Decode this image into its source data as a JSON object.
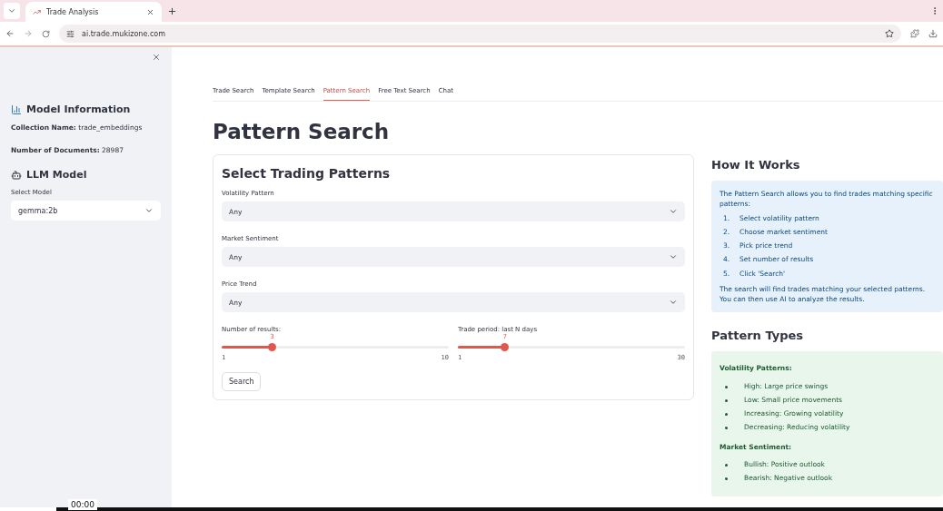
{
  "browser": {
    "tab_title": "Trade Analysis",
    "url": "ai.trade.mukizone.com"
  },
  "sidebar": {
    "sections": [
      {
        "kind": "info",
        "title": "Model Information",
        "lines": [
          {
            "label": "Collection Name:",
            "value": "trade_embeddings"
          },
          {
            "label": "Number of Documents:",
            "value": "28987"
          }
        ]
      },
      {
        "kind": "select",
        "title": "LLM Model",
        "field_label": "Select Model",
        "value": "gemma:2b"
      }
    ]
  },
  "tabs": [
    {
      "label": "Trade Search",
      "selected": false
    },
    {
      "label": "Template Search",
      "selected": false
    },
    {
      "label": "Pattern Search",
      "selected": true
    },
    {
      "label": "Free Text Search",
      "selected": false
    },
    {
      "label": "Chat",
      "selected": false
    }
  ],
  "page_title": "Pattern Search",
  "form": {
    "title": "Select Trading Patterns",
    "selects": [
      {
        "label": "Volatility Pattern",
        "value": "Any"
      },
      {
        "label": "Market Sentiment",
        "value": "Any"
      },
      {
        "label": "Price Trend",
        "value": "Any"
      }
    ],
    "sliders": [
      {
        "label": "Number of results:",
        "reading": "3",
        "min": "1",
        "max": "10",
        "level": 0.222
      },
      {
        "label": "Trade period: last N days",
        "reading": "7",
        "min": "1",
        "max": "30",
        "level": 0.207
      }
    ],
    "button": "Search"
  },
  "how_it_works": {
    "title": "How It Works",
    "intro": "The Pattern Search allows you to find trades matching specific patterns:",
    "steps": [
      {
        "marker": "1.",
        "text": "Select volatility pattern"
      },
      {
        "marker": "2.",
        "text": "Choose market sentiment"
      },
      {
        "marker": "3.",
        "text": "Pick price trend"
      },
      {
        "marker": "4.",
        "text": "Set number of results"
      },
      {
        "marker": "5.",
        "text": "Click 'Search'"
      }
    ],
    "outro": "The search will find trades matching your selected patterns. You can then use AI to analyze the results."
  },
  "pattern_types": {
    "title": "Pattern Types",
    "groups": [
      {
        "heading": "Volatility Patterns:",
        "items": [
          "High: Large price swings",
          "Low: Small price movements",
          "Increasing: Growing volatility",
          "Decreasing: Reducing volatility"
        ]
      },
      {
        "heading": "Market Sentiment:",
        "items": [
          "Bullish: Positive outlook",
          "Bearish: Negative outlook"
        ]
      }
    ]
  },
  "video_bar": {
    "time": "00:00",
    "level": 0.06
  }
}
